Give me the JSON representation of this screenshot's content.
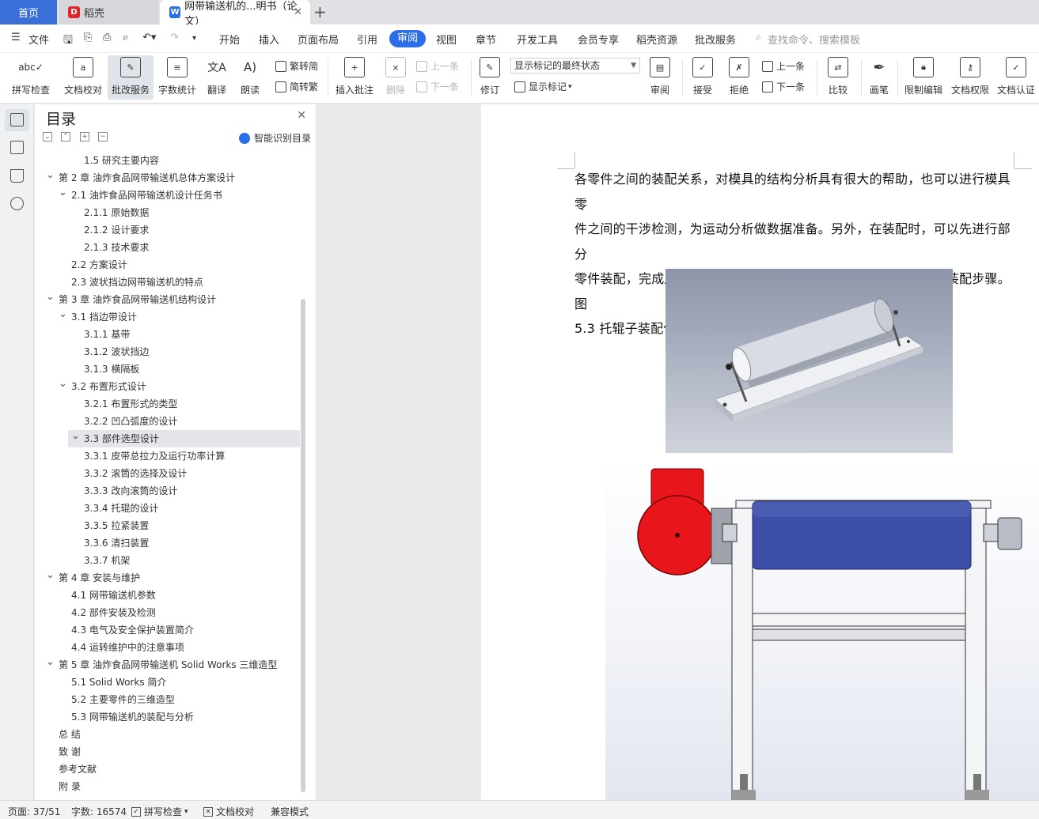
{
  "tabs": {
    "home": "首页",
    "doc1": "稻壳",
    "doc2": "网带输送机的...明书（论文）",
    "add": "+"
  },
  "menu": {
    "file": "文件",
    "items": [
      "开始",
      "插入",
      "页面布局",
      "引用",
      "审阅",
      "视图",
      "章节",
      "开发工具",
      "会员专享",
      "稻壳资源",
      "批改服务"
    ],
    "active": "审阅",
    "search": "查找命令、搜索模板"
  },
  "ribbon": {
    "spell_check": "拼写检查",
    "doc_proof": "文档校对",
    "review_service": "批改服务",
    "word_count": "字数统计",
    "translate": "翻译",
    "read_aloud": "朗读",
    "trad_to_simp": "繁转简",
    "simp_to_trad": "简转繁",
    "insert_comment": "插入批注",
    "delete": "删除",
    "prev": "上一条",
    "next": "下一条",
    "track": "修订",
    "markup_state": "显示标记的最终状态",
    "show_markup": "显示标记",
    "review": "审阅",
    "accept": "接受",
    "reject": "拒绝",
    "prev2": "上一条",
    "next2": "下一条",
    "compare": "比较",
    "pen": "画笔",
    "restrict_edit": "限制编辑",
    "doc_permission": "文档权限",
    "doc_cert": "文档认证"
  },
  "toc": {
    "title": "目录",
    "smart_label": "智能识别目录",
    "items": [
      {
        "text": "1.5  研究主要内容",
        "level": 2,
        "caret": ""
      },
      {
        "text": "第 2 章  油炸食品网带输送机总体方案设计",
        "level": 0,
        "caret": "v"
      },
      {
        "text": "2.1  油炸食品网带输送机设计任务书",
        "level": 1,
        "caret": "v"
      },
      {
        "text": "2.1.1 原始数据",
        "level": 2,
        "caret": ""
      },
      {
        "text": "2.1.2 设计要求",
        "level": 2,
        "caret": ""
      },
      {
        "text": "2.1.3 技术要求",
        "level": 2,
        "caret": ""
      },
      {
        "text": "2.2  方案设计",
        "level": 1,
        "caret": ""
      },
      {
        "text": "2.3  波状挡边网带输送机的特点",
        "level": 1,
        "caret": ""
      },
      {
        "text": "第 3 章  油炸食品网带输送机结构设计",
        "level": 0,
        "caret": "v"
      },
      {
        "text": "3.1 挡边带设计",
        "level": 1,
        "caret": "v"
      },
      {
        "text": "3.1.1  基带",
        "level": 2,
        "caret": ""
      },
      {
        "text": "3.1.2  波状挡边",
        "level": 2,
        "caret": ""
      },
      {
        "text": "3.1.3  横隔板",
        "level": 2,
        "caret": ""
      },
      {
        "text": "3.2 布置形式设计",
        "level": 1,
        "caret": "v"
      },
      {
        "text": "3.2.1  布置形式的类型",
        "level": 2,
        "caret": ""
      },
      {
        "text": "3.2.2 凹凸弧度的设计",
        "level": 2,
        "caret": ""
      },
      {
        "text": "3.3 部件选型设计",
        "level": 1,
        "caret": "v",
        "selected": true
      },
      {
        "text": "3.3.1 皮带总拉力及运行功率计算",
        "level": 2,
        "caret": ""
      },
      {
        "text": "3.3.2 滚筒的选择及设计",
        "level": 2,
        "caret": ""
      },
      {
        "text": "3.3.3 改向滚筒的设计",
        "level": 2,
        "caret": ""
      },
      {
        "text": "3.3.4 托辊的设计",
        "level": 2,
        "caret": ""
      },
      {
        "text": "3.3.5 拉紧装置",
        "level": 2,
        "caret": ""
      },
      {
        "text": "3.3.6 清扫装置",
        "level": 2,
        "caret": ""
      },
      {
        "text": "3.3.7 机架",
        "level": 2,
        "caret": ""
      },
      {
        "text": "第 4 章  安装与维护",
        "level": 0,
        "caret": "v"
      },
      {
        "text": "4.1 网带输送机参数",
        "level": 1,
        "caret": ""
      },
      {
        "text": "4.2 部件安装及检测",
        "level": 1,
        "caret": ""
      },
      {
        "text": "4.3 电气及安全保护装置简介",
        "level": 1,
        "caret": ""
      },
      {
        "text": "4.4 运转维护中的注意事项",
        "level": 1,
        "caret": ""
      },
      {
        "text": "第 5 章  油炸食品网带输送机 Solid Works 三维造型",
        "level": 0,
        "caret": "v"
      },
      {
        "text": "5.1 Solid Works 简介",
        "level": 1,
        "caret": ""
      },
      {
        "text": "5.2  主要零件的三维造型",
        "level": 1,
        "caret": ""
      },
      {
        "text": "5.3  网带输送机的装配与分析",
        "level": 1,
        "caret": ""
      },
      {
        "text": "总    结",
        "level": 0,
        "caret": ""
      },
      {
        "text": "致    谢",
        "level": 0,
        "caret": ""
      },
      {
        "text": "参考文献",
        "level": 0,
        "caret": ""
      },
      {
        "text": "附    录",
        "level": 0,
        "caret": ""
      }
    ]
  },
  "document": {
    "paragraph_lines": [
      "各零件之间的装配关系，对模具的结构分析具有很大的帮助，也可以进行模具零",
      "件之间的干涉检测，为运动分析做数据准备。另外，在装配时，可以先进行部分",
      "零件装配，完成后再进行部件间的装配，这样可以减少装配难度和装配步骤。图",
      "5.3 托辊子装配体。"
    ]
  },
  "status": {
    "page": "页面: 37/51",
    "words": "字数: 16574",
    "spell": "拼写检查",
    "proof": "文档校对",
    "compat": "兼容模式"
  },
  "colors": {
    "accent": "#2b6ee8",
    "home_tab": "#3a6fd8",
    "motor_red": "#e8161a",
    "roller_blue": "#3c4ea8"
  }
}
